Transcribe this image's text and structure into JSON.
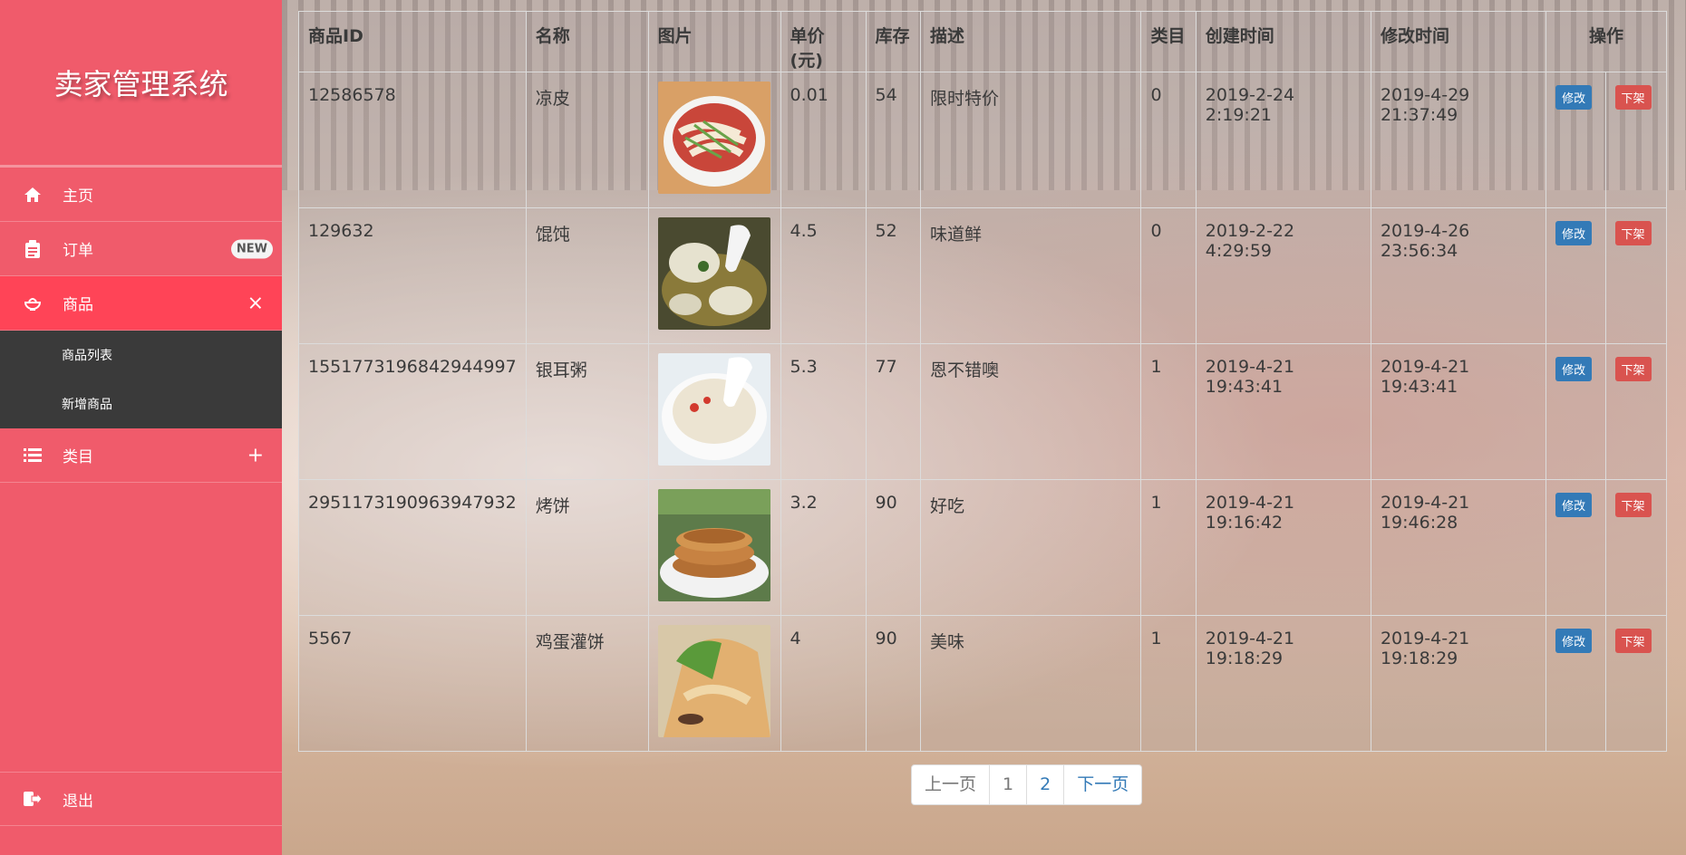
{
  "sidebar": {
    "brand": "卖家管理系统",
    "items": [
      {
        "label": "主页"
      },
      {
        "label": "订单",
        "badge": "NEW"
      },
      {
        "label": "商品",
        "toggle": "×"
      },
      {
        "label": "类目",
        "toggle": "+"
      }
    ],
    "submenu": [
      "商品列表",
      "新增商品"
    ],
    "logout": "退出"
  },
  "table": {
    "headers": [
      "商品ID",
      "名称",
      "图片",
      "单价(元)",
      "库存",
      "描述",
      "类目",
      "创建时间",
      "修改时间",
      "操作"
    ],
    "rows": [
      {
        "id": "12586578",
        "name": "凉皮",
        "price": "0.01",
        "stock": "54",
        "desc": "限时特价",
        "cat": "0",
        "created": "2019-2-24 2:19:21",
        "updated": "2019-4-29 21:37:49",
        "image": "liangpi-noodle-bowl"
      },
      {
        "id": "129632",
        "name": "馄饨",
        "price": "4.5",
        "stock": "52",
        "desc": "味道鲜",
        "cat": "0",
        "created": "2019-2-22 4:29:59",
        "updated": "2019-4-26 23:56:34",
        "image": "wonton-soup-spoon"
      },
      {
        "id": "1551773196842944997",
        "name": "银耳粥",
        "price": "5.3",
        "stock": "77",
        "desc": "恩不错噢",
        "cat": "1",
        "created": "2019-4-21 19:43:41",
        "updated": "2019-4-21 19:43:41",
        "image": "tremella-porridge-bowl"
      },
      {
        "id": "2951173190963947932",
        "name": "烤饼",
        "price": "3.2",
        "stock": "90",
        "desc": "好吃",
        "cat": "1",
        "created": "2019-4-21 19:16:42",
        "updated": "2019-4-21 19:46:28",
        "image": "baked-flatbread-stack"
      },
      {
        "id": "5567",
        "name": "鸡蛋灌饼",
        "price": "4",
        "stock": "90",
        "desc": "美味",
        "cat": "1",
        "created": "2019-4-21 19:18:29",
        "updated": "2019-4-21 19:18:29",
        "image": "egg-pancake-wrap"
      }
    ],
    "edit_label": "修改",
    "off_label": "下架"
  },
  "pager": {
    "prev": "上一页",
    "pages": [
      "1",
      "2"
    ],
    "next": "下一页"
  },
  "colors": {
    "sidebar": "#f05b6b",
    "active": "#ff4457",
    "submenu": "#3a3a3a",
    "edit": "#337ab7",
    "off": "#d9534f"
  }
}
